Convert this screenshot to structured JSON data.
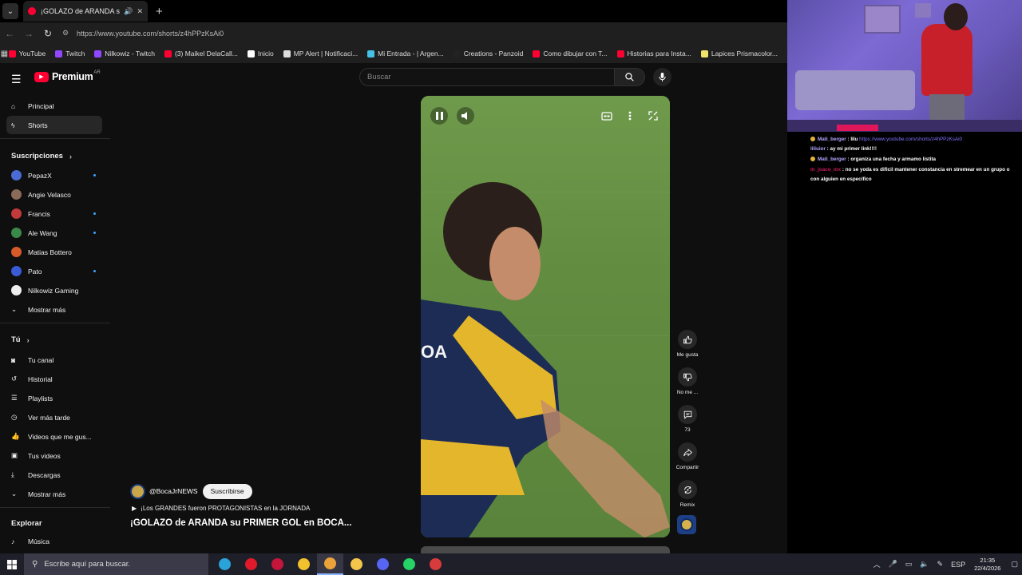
{
  "browser": {
    "tab_title": "¡GOLAZO de ARANDA su PRIMER GOL en BOCA",
    "url": "https://www.youtube.com/shorts/z4hPPzKsAi0",
    "bookmarks": [
      {
        "label": "YouTube",
        "color": "#ff0033"
      },
      {
        "label": "Twitch",
        "color": "#9146ff"
      },
      {
        "label": "Nilkowiz - Twitch",
        "color": "#9146ff"
      },
      {
        "label": "(3) Maikel DelaCall...",
        "color": "#ff0033"
      },
      {
        "label": "Inicio",
        "color": "#ffffff"
      },
      {
        "label": "MP Alert | Notificaci...",
        "color": "#dddddd"
      },
      {
        "label": "Mi Entrada - | Argen...",
        "color": "#46c1e6"
      },
      {
        "label": "Creations - Panzoid",
        "color": "#222222"
      },
      {
        "label": "Como dibujar con T...",
        "color": "#ff0033"
      },
      {
        "label": "Historias para Insta...",
        "color": "#ff0033"
      },
      {
        "label": "Lapices Prismacolor...",
        "color": "#f0e36a"
      }
    ]
  },
  "youtube": {
    "logo_text": "Premium",
    "logo_region": "AR",
    "search_placeholder": "Buscar",
    "sidebar": {
      "main": [
        {
          "label": "Principal",
          "icon": "home-icon"
        },
        {
          "label": "Shorts",
          "icon": "shorts-icon",
          "active": true
        }
      ],
      "subs_header": "Suscripciones",
      "subscriptions": [
        {
          "label": "PepazX",
          "color": "#4a6bd6",
          "live": true
        },
        {
          "label": "Angie Velasco",
          "color": "#8b6a5a",
          "live": false
        },
        {
          "label": "Francis",
          "color": "#c23a3a",
          "live": true
        },
        {
          "label": "Ale Wang",
          "color": "#3a8a4a",
          "live": true
        },
        {
          "label": "Matias Bottero",
          "color": "#d65a2a",
          "live": false
        },
        {
          "label": "Pato",
          "color": "#3a5ad6",
          "live": true
        },
        {
          "label": "Nilkowiz Gaming",
          "color": "#eeeeee",
          "live": false
        }
      ],
      "subs_more": "Mostrar más",
      "you_header": "Tú",
      "you_items": [
        {
          "label": "Tu canal",
          "icon": "channel-icon"
        },
        {
          "label": "Historial",
          "icon": "history-icon"
        },
        {
          "label": "Playlists",
          "icon": "playlists-icon"
        },
        {
          "label": "Ver más tarde",
          "icon": "watch-later-icon"
        },
        {
          "label": "Videos que me gus...",
          "icon": "liked-icon"
        },
        {
          "label": "Tus videos",
          "icon": "your-videos-icon"
        },
        {
          "label": "Descargas",
          "icon": "downloads-icon"
        }
      ],
      "you_more": "Mostrar más",
      "explore_header": "Explorar",
      "explore_items": [
        {
          "label": "Música",
          "icon": "music-icon"
        }
      ]
    },
    "short": {
      "channel": "@BocaJrNEWS",
      "subscribe_label": "Suscribirse",
      "playlist": "¡Los GRANDES fueron PROTAGONISTAS en la JORNADA",
      "title": "¡GOLAZO de ARANDA su PRIMER GOL en BOCA..."
    },
    "actions": [
      {
        "label": "Me gusta",
        "icon": "like-icon"
      },
      {
        "label": "No me ...",
        "icon": "dislike-icon"
      },
      {
        "label": "73",
        "icon": "comment-icon"
      },
      {
        "label": "Compartir",
        "icon": "share-icon"
      },
      {
        "label": "Remix",
        "icon": "remix-icon"
      }
    ]
  },
  "chat": {
    "messages": [
      {
        "user": "Mati_berger",
        "badge": true,
        "text": "lilu",
        "link": "https://www.youtube.com/shorts/z4hPPzKsAi0",
        "pink": false
      },
      {
        "user": "liliuior",
        "badge": false,
        "text": "ay mi primer link!!!!",
        "link": "",
        "pink": false
      },
      {
        "user": "Mati_berger",
        "badge": true,
        "text": "organiza una fecha y armamo listita",
        "link": "",
        "pink": false
      },
      {
        "user": "m_joaco_mx",
        "badge": false,
        "text": "no se yoda es dificil mantener constancia en stremear en un grupo o con alguien en especifico",
        "link": "",
        "pink": true
      }
    ]
  },
  "taskbar": {
    "search_placeholder": "Escribe aquí para buscar.",
    "apps": [
      {
        "name": "edge",
        "color": "#2aa3d8"
      },
      {
        "name": "opera",
        "color": "#e01a2a"
      },
      {
        "name": "opera-gx",
        "color": "#c3163a"
      },
      {
        "name": "store",
        "color": "#f2c12e"
      },
      {
        "name": "chrome",
        "color": "#e9a33a"
      },
      {
        "name": "explorer",
        "color": "#f3c54a"
      },
      {
        "name": "discord",
        "color": "#5865f2"
      },
      {
        "name": "whatsapp",
        "color": "#25d366"
      },
      {
        "name": "app-red",
        "color": "#d83b3b"
      }
    ],
    "lang": "ESP",
    "time": "21:35",
    "date": "22/4/2026"
  }
}
